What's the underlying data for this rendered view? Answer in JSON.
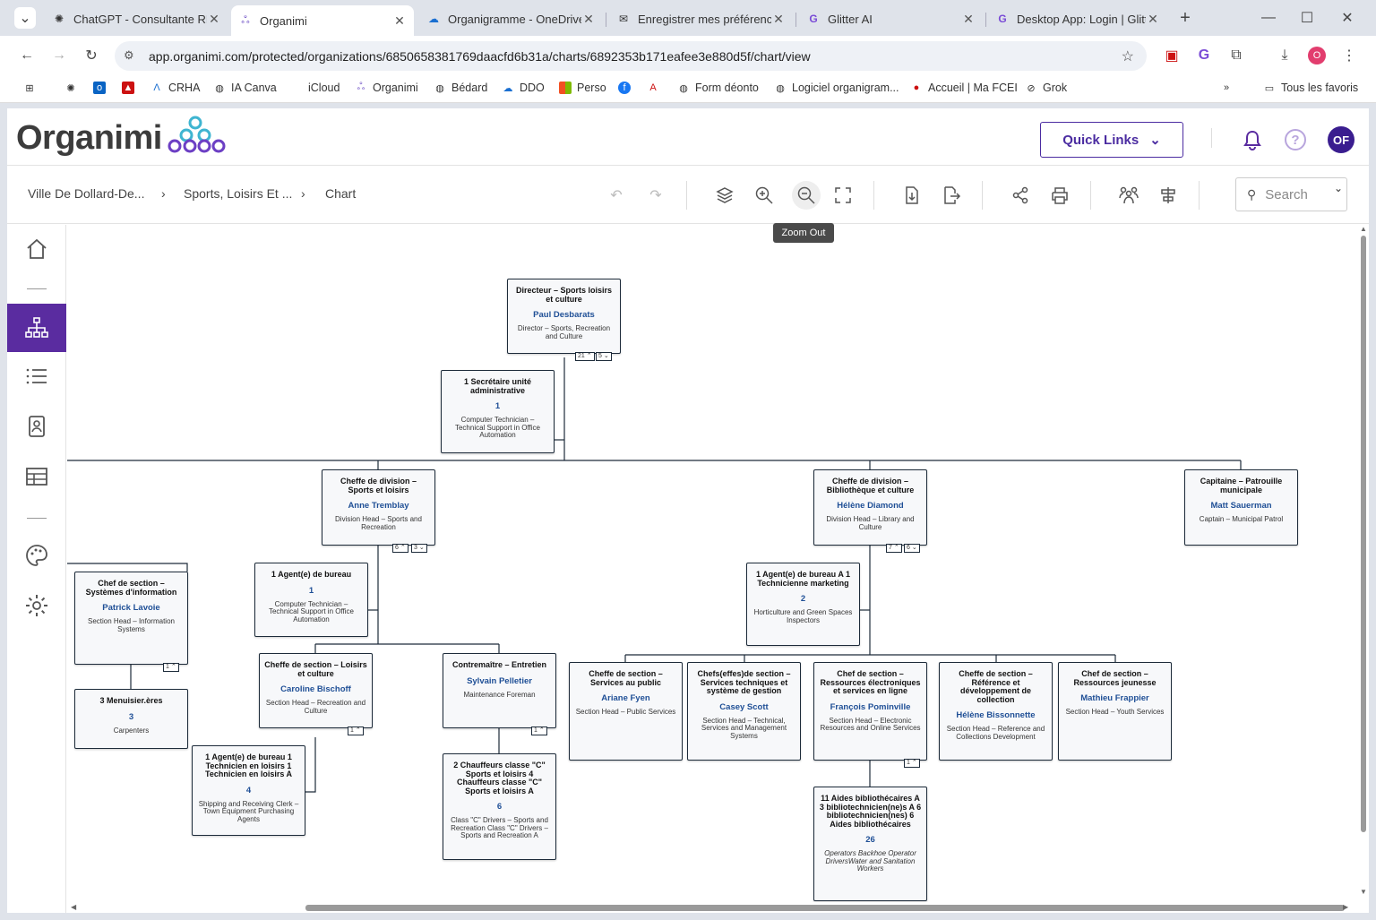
{
  "browser": {
    "tabs": [
      {
        "title": "ChatGPT - Consultante RH",
        "icon": "chatgpt-icon"
      },
      {
        "title": "Organimi",
        "icon": "organimi-icon",
        "active": true
      },
      {
        "title": "Organigramme - OneDrive",
        "icon": "onedrive-icon"
      },
      {
        "title": "Enregistrer mes préférence",
        "icon": "mail-icon"
      },
      {
        "title": "Glitter AI",
        "icon": "glitter-icon"
      },
      {
        "title": "Desktop App: Login | Glitte",
        "icon": "glitter-icon"
      }
    ],
    "url": "app.organimi.com/protected/organizations/6850658381769daacfd6b31a/charts/6892353b171eafee3e880d5f/chart/view",
    "bookmarks": [
      "CRHA",
      "IA Canva",
      "iCloud",
      "Organimi",
      "Bédard",
      "DDO",
      "Perso",
      "Form déonto",
      "Logiciel organigram...",
      "Accueil | Ma FCEI",
      "Grok"
    ],
    "all_bookmarks": "Tous les favoris",
    "profile_initial": "O"
  },
  "app": {
    "logo": "Organimi",
    "quick_links": "Quick Links",
    "avatar_initials": "OF",
    "breadcrumb": [
      "Ville De Dollard-De...",
      "Sports, Loisirs Et ...",
      "Chart"
    ],
    "search_placeholder": "Search",
    "tooltip": "Zoom Out"
  },
  "chart": {
    "director": {
      "title": "Directeur – Sports loisirs et culture",
      "name": "Paul Desbarats",
      "desc": "Director – Sports, Recreation and Culture",
      "b1": "21",
      "b2": "5"
    },
    "secretary": {
      "title": "1 Secrétaire unité administrative",
      "name": "1",
      "desc": "Computer Technician – Technical Support in Office Automation"
    },
    "div_sports": {
      "title": "Cheffe de division – Sports et loisirs",
      "name": "Anne Tremblay",
      "desc": "Division Head – Sports and Recreation",
      "b1": "6",
      "b2": "3"
    },
    "div_library": {
      "title": "Cheffe de division – Bibliothèque et culture",
      "name": "Hélène Diamond",
      "desc": "Division Head – Library and Culture",
      "b1": "7",
      "b2": "6"
    },
    "captain": {
      "title": "Capitaine – Patrouille municipale",
      "name": "Matt Sauerman",
      "desc": "Captain – Municipal Patrol"
    },
    "info_systems": {
      "title": "Chef de section – Systèmes d'information",
      "name": "Patrick Lavoie",
      "desc": "Section Head – Information Systems",
      "b1": "1"
    },
    "agent_bureau": {
      "title": "1 Agent(e) de bureau",
      "name": "1",
      "desc": "Computer Technician – Technical Support in Office Automation"
    },
    "agent_bureau_a": {
      "title": "1 Agent(e) de bureau A 1 Technicienne marketing",
      "name": "2",
      "desc": "Horticulture and Green Spaces Inspectors"
    },
    "menuisiers": {
      "title": "3 Menuisier.ères",
      "name": "3",
      "desc": "Carpenters"
    },
    "loisirs_culture": {
      "title": "Cheffe de section – Loisirs et culture",
      "name": "Caroline Bischoff",
      "desc": "Section Head – Recreation and Culture",
      "b1": "1"
    },
    "contremaitre": {
      "title": "Contremaître – Entretien",
      "name": "Sylvain Pelletier",
      "desc": "Maintenance Foreman",
      "b1": "1"
    },
    "agent_tech": {
      "title": "1 Agent(e) de bureau 1 Technicien en loisirs 1 Technicien en loisirs A",
      "name": "4",
      "desc": "Shipping and Receiving Clerk – Town Equipment Purchasing Agents"
    },
    "chauffeurs": {
      "title": "2 Chauffeurs classe \"C\" Sports et loisirs 4 Chauffeurs classe \"C\" Sports et loisirs A",
      "name": "6",
      "desc": "Class \"C\" Drivers – Sports and Recreation Class \"C\" Drivers – Sports and Recreation A"
    },
    "public": {
      "title": "Cheffe de section – Services au public",
      "name": "Ariane Fyen",
      "desc": "Section Head – Public Services"
    },
    "tech_services": {
      "title": "Chefs(effes)de section – Services techniques et système de gestion",
      "name": "Casey Scott",
      "desc": "Section Head – Technical, Services and Management Systems"
    },
    "electronic": {
      "title": "Chef de section – Ressources électroniques et services en ligne",
      "name": "François Pominville",
      "desc": "Section Head – Electronic Resources and Online Services",
      "b1": "1"
    },
    "reference": {
      "title": "Cheffe de section – Référence et développement de collection",
      "name": "Hélène Bissonnette",
      "desc": "Section Head – Reference and Collections Development"
    },
    "youth": {
      "title": "Chef de section – Ressources jeunesse",
      "name": "Mathieu Frappier",
      "desc": "Section Head – Youth Services"
    },
    "aides": {
      "title": "11 Aides bibliothécaires A 3 bibliotechnicien(ne)s A 6 bibliotechnicien(nes) 6 Aides bibliothécaires",
      "name": "26",
      "desc": "Operators Backhoe Operator DriversWater and Sanitation Workers"
    }
  }
}
